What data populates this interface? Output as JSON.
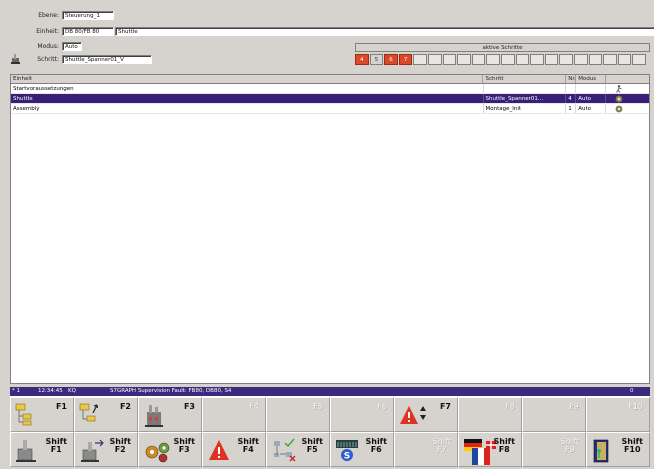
{
  "header": {
    "ebene_label": "Ebene:",
    "ebene_value": "Steuerung_1",
    "einheit_label": "Einheit:",
    "einheit_code": "DB 80/FB 80",
    "einheit_value": "Shuttle",
    "modus_label": "Modus:",
    "modus_value": "Auto",
    "schritt_label": "Schritt:",
    "schritt_value": "Shuttle_Spanner01_V"
  },
  "active_steps": {
    "title": "aktive Schritte",
    "cells": [
      "4",
      "5",
      "6",
      "7",
      "",
      "",
      "",
      "",
      "",
      "",
      "",
      "",
      "",
      "",
      "",
      "",
      "",
      "",
      "",
      ""
    ]
  },
  "table": {
    "columns": [
      "Einheit",
      "Schritt",
      "Nr.",
      "Modus",
      ""
    ],
    "rows": [
      {
        "einheit": "Startvoraussetzungen",
        "schritt": "",
        "nr": "",
        "modus": "",
        "icon": "walking-figure-icon",
        "selected": false
      },
      {
        "einheit": "Shuttle",
        "schritt": "Shuttle_Spanner01...",
        "nr": "4",
        "modus": "Auto",
        "icon": "gear-icon",
        "selected": true
      },
      {
        "einheit": "Assembly",
        "schritt": "Montage_Init",
        "nr": "1",
        "modus": "Auto",
        "icon": "gear-icon",
        "selected": false
      }
    ]
  },
  "status_bar": {
    "marker": "* 1",
    "time": "12:34:45",
    "code": "KQ",
    "message": "S7GRAPH Supervision Fault: FB80, DB80, S4",
    "count": "0"
  },
  "fkeys_row1": [
    {
      "label": "F1",
      "icon": "folder-tree-icon",
      "enabled": true
    },
    {
      "label": "F2",
      "icon": "tree-up-icon",
      "enabled": true
    },
    {
      "label": "F3",
      "icon": "factory-icon",
      "enabled": true
    },
    {
      "label": "F4",
      "icon": "",
      "enabled": false
    },
    {
      "label": "F5",
      "icon": "",
      "enabled": false
    },
    {
      "label": "F6",
      "icon": "",
      "enabled": false
    },
    {
      "label": "F7",
      "icon": "warning-sort-icon",
      "enabled": true
    },
    {
      "label": "F8",
      "icon": "",
      "enabled": false
    },
    {
      "label": "F9",
      "icon": "",
      "enabled": false
    },
    {
      "label": "F10",
      "icon": "",
      "enabled": false
    }
  ],
  "fkeys_row2": [
    {
      "label": "Shift\nF1",
      "icon": "machine-icon",
      "enabled": true
    },
    {
      "label": "Shift\nF2",
      "icon": "machine-arrow-icon",
      "enabled": true
    },
    {
      "label": "Shift\nF3",
      "icon": "gears-icon",
      "enabled": true
    },
    {
      "label": "Shift\nF4",
      "icon": "warning-icon",
      "enabled": true
    },
    {
      "label": "Shift\nF5",
      "icon": "network-check-icon",
      "enabled": true
    },
    {
      "label": "Shift\nF6",
      "icon": "plc-s-icon",
      "enabled": true
    },
    {
      "label": "Shift\nF7",
      "icon": "",
      "enabled": false
    },
    {
      "label": "Shift\nF8",
      "icon": "language-flag-icon",
      "enabled": true
    },
    {
      "label": "Shift\nF9",
      "icon": "",
      "enabled": false
    },
    {
      "label": "Shift\nF10",
      "icon": "exit-door-icon",
      "enabled": true
    }
  ],
  "colors": {
    "selection": "#3a1f7a",
    "status_bar": "#3b2a7e",
    "step_active": "#d94a2a",
    "panel": "#d6d3ce"
  }
}
